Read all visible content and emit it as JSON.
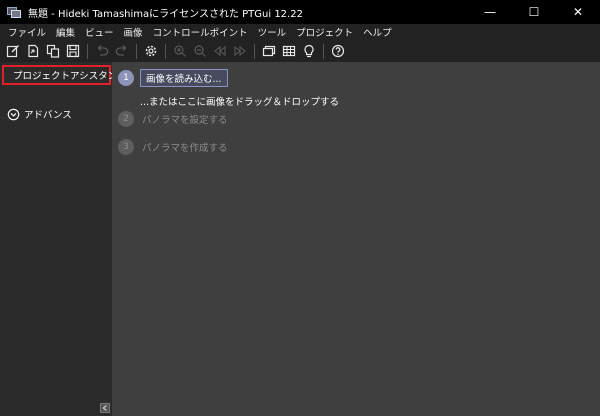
{
  "window": {
    "title": "無題 - Hideki Tamashimaにライセンスされた PTGui 12.22",
    "minimize": "—",
    "maximize": "☐",
    "close": "✕"
  },
  "menu": [
    "ファイル",
    "編集",
    "ビュー",
    "画像",
    "コントロールポイント",
    "ツール",
    "プロジェクト",
    "ヘルプ"
  ],
  "sidebar": {
    "items": [
      {
        "label": "プロジェクトアシスタント",
        "icon": "home-icon"
      },
      {
        "label": "アドバンス",
        "icon": "chevron-circle-down-icon"
      }
    ],
    "collapse": "collapse-arrow-icon"
  },
  "steps": [
    {
      "number": "1",
      "button": "画像を読み込む..."
    },
    {
      "hint": "...またはここに画像をドラッグ＆ドロップする"
    },
    {
      "number": "2",
      "label": "パノラマを設定する"
    },
    {
      "number": "3",
      "label": "パノラマを作成する"
    }
  ],
  "colors": {
    "highlight": "#e0202a",
    "accent": "#8d94b8"
  }
}
